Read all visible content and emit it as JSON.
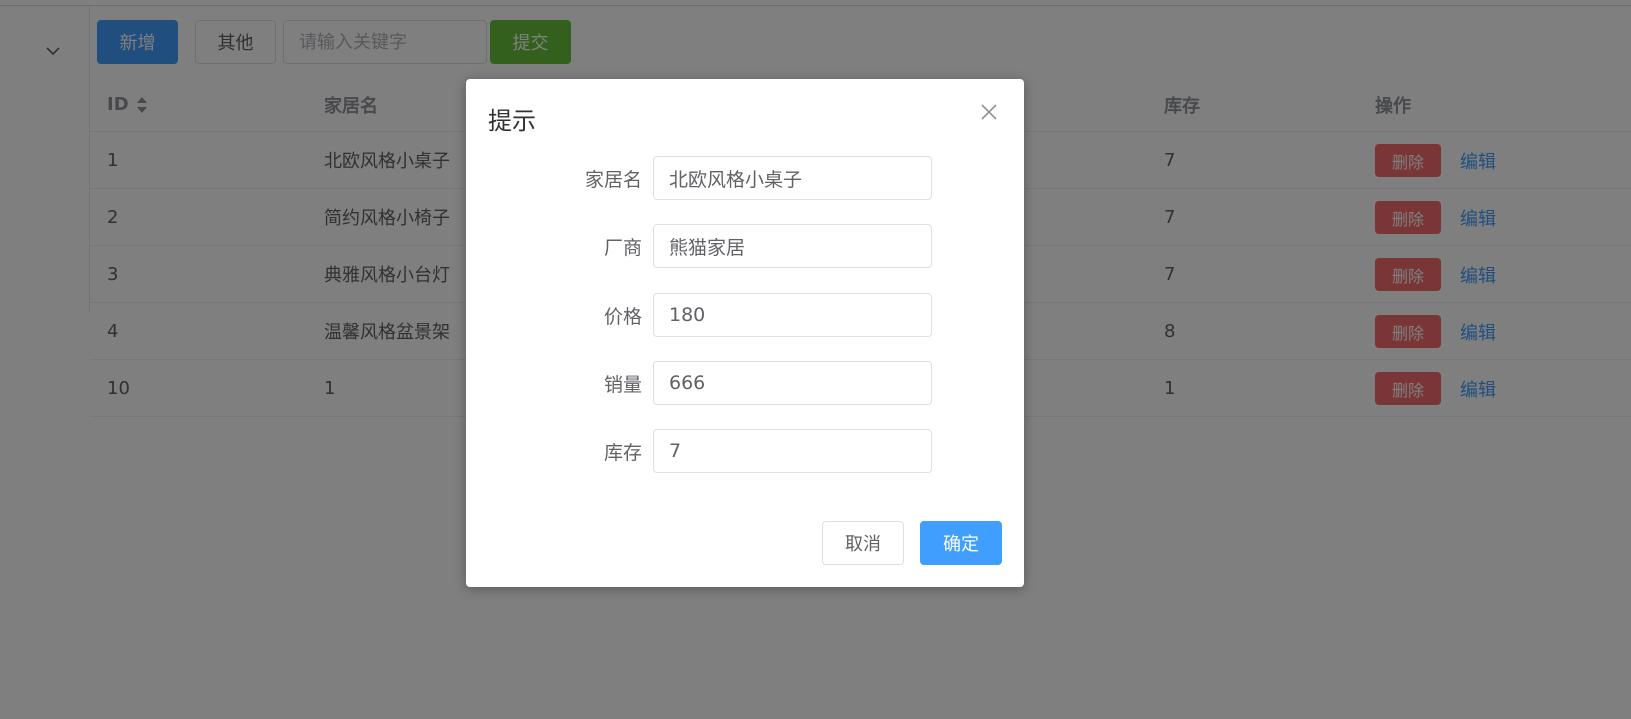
{
  "toolbar": {
    "add_label": "新增",
    "other_label": "其他",
    "search_placeholder": "请输入关键字",
    "submit_label": "提交"
  },
  "table": {
    "headers": {
      "id": "ID",
      "name": "家居名",
      "stock": "库存",
      "ops": "操作"
    },
    "rows": [
      {
        "id": "1",
        "name": "北欧风格小桌子",
        "stock": "7",
        "delete_label": "删除",
        "edit_label": "编辑"
      },
      {
        "id": "2",
        "name": "简约风格小椅子",
        "stock": "7",
        "delete_label": "删除",
        "edit_label": "编辑"
      },
      {
        "id": "3",
        "name": "典雅风格小台灯",
        "stock": "7",
        "delete_label": "删除",
        "edit_label": "编辑"
      },
      {
        "id": "4",
        "name": "温馨风格盆景架",
        "stock": "8",
        "delete_label": "删除",
        "edit_label": "编辑"
      },
      {
        "id": "10",
        "name": "1",
        "stock": "1",
        "delete_label": "删除",
        "edit_label": "编辑"
      }
    ]
  },
  "dialog": {
    "title": "提示",
    "fields": [
      {
        "label": "家居名",
        "value": "北欧风格小桌子"
      },
      {
        "label": "厂商",
        "value": "熊猫家居"
      },
      {
        "label": "价格",
        "value": "180"
      },
      {
        "label": "销量",
        "value": "666"
      },
      {
        "label": "库存",
        "value": "7"
      }
    ],
    "cancel_label": "取消",
    "ok_label": "确定"
  },
  "colors": {
    "primary": "#409eff",
    "success": "#67c23a",
    "danger": "#f56c6c"
  },
  "icons": [
    "chevron-down-icon",
    "sort-icon",
    "close-icon"
  ]
}
